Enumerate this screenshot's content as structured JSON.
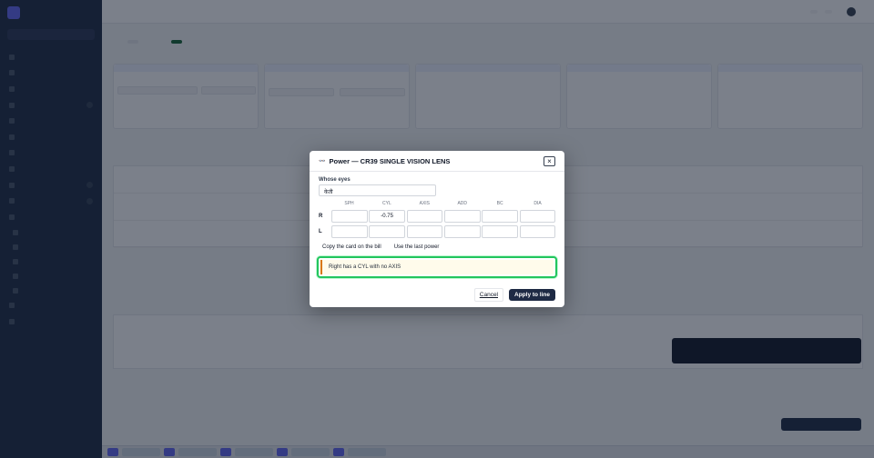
{
  "modal": {
    "icon_text": "👓",
    "title": "Power — CR39 SINGLE VISION LENS",
    "close": "×",
    "whose_eyes_label": "Whose eyes",
    "whose_eyes_value": "केती",
    "columns": [
      "SPH",
      "CYL",
      "AXIS",
      "ADD",
      "BC",
      "DIA"
    ],
    "rows": [
      {
        "eye": "R",
        "values": [
          "",
          "-0.75",
          "",
          "",
          "",
          ""
        ]
      },
      {
        "eye": "L",
        "values": [
          "",
          "",
          "",
          "",
          "",
          ""
        ]
      }
    ],
    "copy_card_label": "Copy the card on the bill",
    "use_last_label": "Use the last power",
    "warning_text": "Right has a CYL with no AXIS",
    "cancel_label": "Cancel",
    "apply_label": "Apply to line"
  }
}
